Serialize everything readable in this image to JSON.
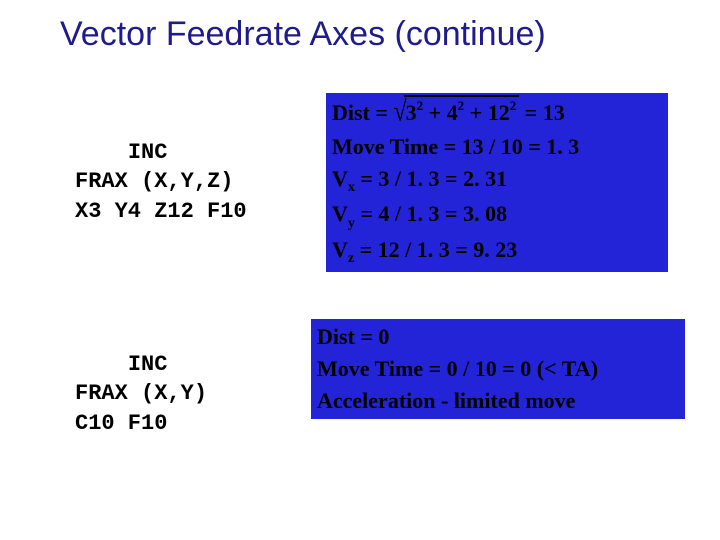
{
  "title": "Vector Feedrate Axes (continue)",
  "code1": {
    "l1": "INC",
    "l2": "FRAX (X,Y,Z)",
    "l3": "X3 Y4 Z12 F10"
  },
  "code2": {
    "l1": "INC",
    "l2": "FRAX (X,Y)",
    "l3": "C10 F10"
  },
  "math1": {
    "dist_label": "Dist = ",
    "dist_a": "3",
    "dist_ap": "2",
    "dist_b": "4",
    "dist_bp": "2",
    "dist_c": "12",
    "dist_cp": "2",
    "dist_eq_result": " = 13",
    "movetime": "Move Time = 13 / 10 = 1. 3",
    "vx_label": "V",
    "vx_sub": "x",
    "vx_rest": " = 3 / 1. 3 = 2. 31",
    "vy_label": "V",
    "vy_sub": "y",
    "vy_rest": " = 4 / 1. 3 = 3. 08",
    "vz_label": "V",
    "vz_sub": "z",
    "vz_rest": " = 12 / 1. 3 = 9. 23"
  },
  "math2": {
    "dist": "Dist = 0",
    "movetime": "Move Time = 0 / 10 = 0 (< TA)",
    "accel": "Acceleration  -  limited move"
  }
}
